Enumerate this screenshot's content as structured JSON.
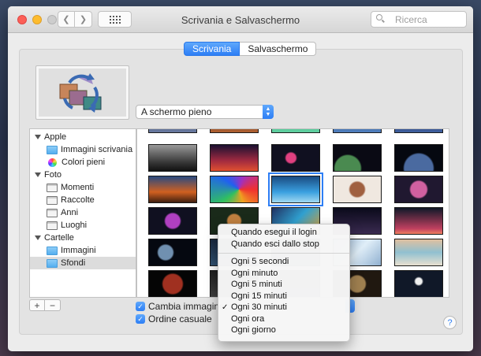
{
  "window": {
    "title": "Scrivania e Salvaschermo",
    "search_placeholder": "Ricerca"
  },
  "tabs": [
    {
      "label": "Scrivania",
      "active": true
    },
    {
      "label": "Salvaschermo",
      "active": false
    }
  ],
  "fit_popup": {
    "value": "A schermo pieno"
  },
  "sidebar": {
    "groups": [
      {
        "label": "Apple",
        "items": [
          {
            "label": "Immagini scrivania",
            "icon": "folder-icon"
          },
          {
            "label": "Colori pieni",
            "icon": "color-wheel-icon"
          }
        ]
      },
      {
        "label": "Foto",
        "items": [
          {
            "label": "Momenti",
            "icon": "photos-icon"
          },
          {
            "label": "Raccolte",
            "icon": "photos-icon"
          },
          {
            "label": "Anni",
            "icon": "photos-icon"
          },
          {
            "label": "Luoghi",
            "icon": "photos-icon"
          }
        ]
      },
      {
        "label": "Cartelle",
        "items": [
          {
            "label": "Immagini",
            "icon": "folder-icon"
          },
          {
            "label": "Sfondi",
            "icon": "folder-icon",
            "selected": true
          }
        ]
      }
    ]
  },
  "controls": {
    "add_label": "+",
    "remove_label": "−",
    "change_picture_label": "Cambia immagine:",
    "change_picture_checked": true,
    "random_order_label": "Ordine casuale",
    "random_order_checked": true,
    "help_label": "?"
  },
  "interval_menu": {
    "items": [
      "Quando esegui il login",
      "Quando esci dallo stop",
      "Ogni 5 secondi",
      "Ogni minuto",
      "Ogni 5 minuti",
      "Ogni 15 minuti",
      "Ogni 30 minuti",
      "Ogni ora",
      "Ogni giorno"
    ],
    "selected": "Ogni 30 minuti",
    "check_mark": "✓"
  },
  "colors": {
    "accent": "#2d7ef5",
    "window_bg": "#ececec"
  }
}
